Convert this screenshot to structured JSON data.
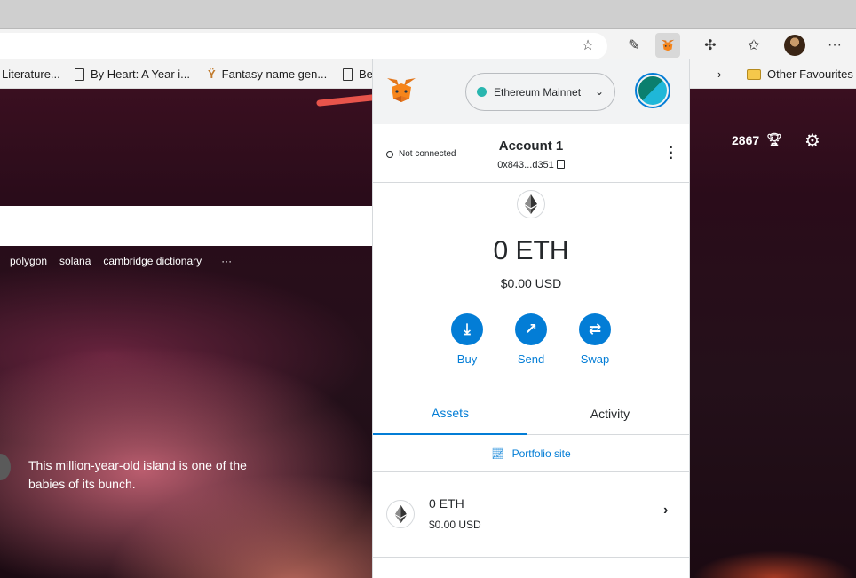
{
  "browser": {
    "bookmarks": [
      {
        "label": "Literature..."
      },
      {
        "label": "By Heart: A Year i..."
      },
      {
        "label": "Fantasy name gen..."
      },
      {
        "label": "Be"
      },
      {
        "label": "Other Favourites"
      }
    ]
  },
  "page": {
    "trending": [
      "polygon",
      "solana",
      "cambridge dictionary",
      "···"
    ],
    "caption": "This million-year-old island is one of the babies of its bunch.",
    "points": "2867"
  },
  "metamask": {
    "network": "Ethereum Mainnet",
    "connection_status": "Not connected",
    "account_name": "Account 1",
    "account_address": "0x843...d351",
    "balance": "0 ETH",
    "balance_usd": "$0.00 USD",
    "actions": {
      "buy": "Buy",
      "send": "Send",
      "swap": "Swap"
    },
    "tabs": {
      "assets": "Assets",
      "activity": "Activity"
    },
    "portfolio_link": "Portfolio site",
    "assets": [
      {
        "amount": "0 ETH",
        "value": "$0.00 USD"
      }
    ]
  },
  "colors": {
    "accent": "#037dd6",
    "network_dot": "#29b6af",
    "arrow": "#e8544b"
  }
}
